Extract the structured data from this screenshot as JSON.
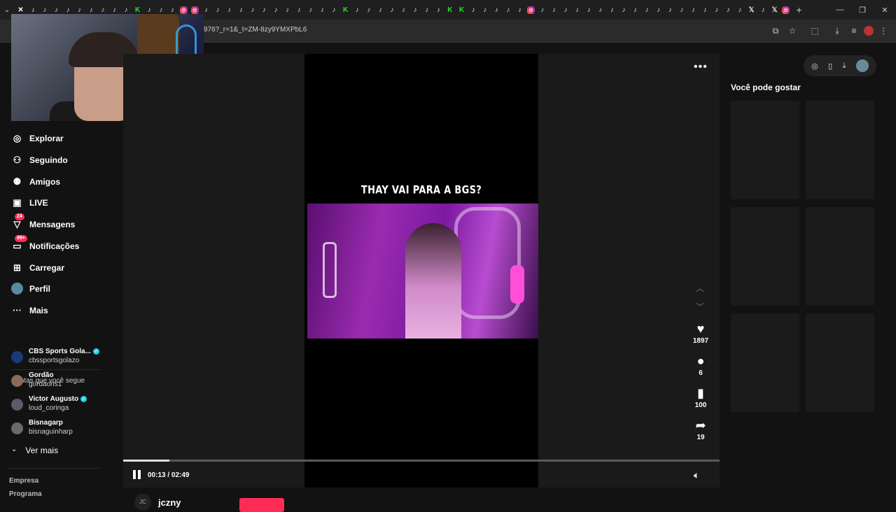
{
  "browser": {
    "url": "976?_r=1&_t=ZM-8zy9YMXPbL6",
    "new_tab": "+",
    "tab_favicons": [
      "♪",
      "♪",
      "♪",
      "♪",
      "♪",
      "♪",
      "♪",
      "♪",
      "♪",
      "K",
      "♪",
      "♪",
      "♪",
      "◎",
      "◎",
      "♪",
      "♪",
      "♪",
      "♪",
      "♪",
      "♪",
      "♪",
      "♪",
      "♪",
      "♪",
      "♪",
      "♪",
      "K",
      "♪",
      "♪",
      "♪",
      "♪",
      "♪",
      "♪",
      "♪",
      "♪",
      "K",
      "K",
      "♪",
      "♪",
      "♪",
      "♪",
      "♪",
      "◎",
      "♪",
      "♪",
      "♪",
      "♪",
      "♪",
      "♪",
      "♪",
      "♪",
      "♪",
      "♪",
      "♪",
      "♪",
      "♪",
      "♪",
      "♪",
      "♪",
      "♪",
      "♪",
      "𝕏",
      "♪",
      "𝕏",
      "◎"
    ]
  },
  "sidebar": {
    "nav": [
      {
        "label": "Explorar",
        "icon": "compass-icon",
        "glyph": "◎"
      },
      {
        "label": "Seguindo",
        "icon": "following-icon",
        "glyph": "⚇"
      },
      {
        "label": "Amigos",
        "icon": "friends-icon",
        "glyph": "⚉"
      },
      {
        "label": "LIVE",
        "icon": "live-icon",
        "glyph": "▣"
      },
      {
        "label": "Mensagens",
        "icon": "messages-icon",
        "glyph": "▽",
        "badge": "24"
      },
      {
        "label": "Notificações",
        "icon": "notifications-icon",
        "glyph": "▭",
        "badge": "99+"
      },
      {
        "label": "Carregar",
        "icon": "upload-icon",
        "glyph": "⊞"
      },
      {
        "label": "Perfil",
        "icon": "profile-avatar-icon",
        "glyph": "●"
      },
      {
        "label": "Mais",
        "icon": "more-icon",
        "glyph": "···"
      }
    ],
    "following_title": "Contas que você segue",
    "accounts": [
      {
        "name": "CBS Sports Gola...",
        "user": "cbssportsgolazo",
        "verified": true,
        "color": "#1a3a7a"
      },
      {
        "name": "Gordão",
        "user": "gordaons1",
        "verified": false,
        "color": "#8a6a5a"
      },
      {
        "name": "Victor Augusto",
        "user": "loud_coringa",
        "verified": true,
        "color": "#5a5a6a"
      },
      {
        "name": "Bisnagarp",
        "user": "bisnaguinharp",
        "verified": false,
        "color": "#6a6a6a"
      }
    ],
    "see_more": "Ver mais",
    "footer": [
      "Empresa",
      "Programa"
    ]
  },
  "video": {
    "caption": "THAY VAI PARA A BGS?",
    "time": "00:13 / 02:49",
    "progress": 0.077,
    "likes": "1897",
    "comments": "6",
    "saves": "100",
    "shares": "19",
    "author_initials": "JC",
    "author": "jczny"
  },
  "right": {
    "title": "Você pode gostar"
  }
}
